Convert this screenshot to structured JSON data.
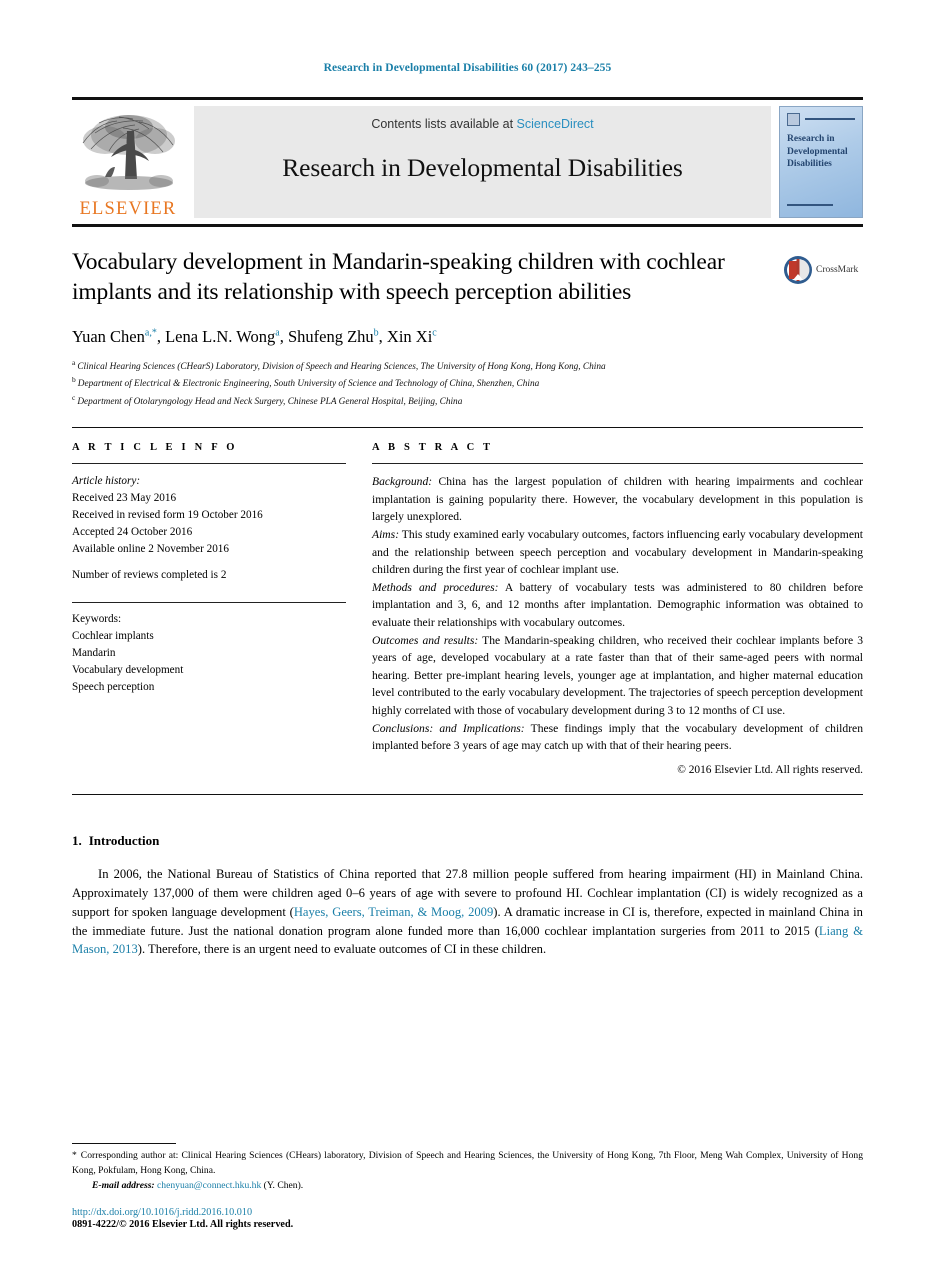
{
  "running_head": "Research in Developmental Disabilities 60 (2017) 243–255",
  "masthead": {
    "publisher_name": "ELSEVIER",
    "publisher_logo_icon": "elsevier-tree-icon",
    "contents_prefix": "Contents lists available at ",
    "contents_link": "ScienceDirect",
    "journal_name": "Research in Developmental Disabilities",
    "cover_title": "Research in Developmental Disabilities",
    "cover_icon": "journal-cover-mark-icon"
  },
  "article": {
    "title": "Vocabulary development in Mandarin-speaking children with cochlear implants and its relationship with speech perception abilities",
    "crossmark_label": "CrossMark",
    "crossmark_icon": "crossmark-logo-icon",
    "authors": [
      {
        "name": "Yuan Chen",
        "marks": "a,*"
      },
      {
        "name": "Lena L.N. Wong",
        "marks": "a"
      },
      {
        "name": "Shufeng Zhu",
        "marks": "b"
      },
      {
        "name": "Xin Xi",
        "marks": "c"
      }
    ],
    "affiliations": [
      {
        "mark": "a",
        "text": "Clinical Hearing Sciences (CHearS) Laboratory, Division of Speech and Hearing Sciences, The University of Hong Kong, Hong Kong, China"
      },
      {
        "mark": "b",
        "text": "Department of Electrical & Electronic Engineering, South University of Science and Technology of China, Shenzhen, China"
      },
      {
        "mark": "c",
        "text": "Department of Otolaryngology Head and Neck Surgery, Chinese PLA General Hospital, Beijing, China"
      }
    ]
  },
  "article_info": {
    "heading": "A R T I C L E   I N F O",
    "history_label": "Article history:",
    "history": [
      "Received 23 May 2016",
      "Received in revised form 19 October 2016",
      "Accepted 24 October 2016",
      "Available online 2 November 2016"
    ],
    "review_count_line": "Number of reviews completed is 2",
    "keywords_label": "Keywords:",
    "keywords": [
      "Cochlear implants",
      "Mandarin",
      "Vocabulary development",
      "Speech perception"
    ]
  },
  "abstract": {
    "heading": "A B S T R A C T",
    "sections": [
      {
        "label": "Background:",
        "text": " China has the largest population of children with hearing impairments and cochlear implantation is gaining popularity there. However, the vocabulary development in this population is largely unexplored."
      },
      {
        "label": "Aims:",
        "text": " This study examined early vocabulary outcomes, factors influencing early vocabulary development and the relationship between speech perception and vocabulary development in Mandarin-speaking children during the first year of cochlear implant use."
      },
      {
        "label": "Methods and procedures:",
        "text": " A battery of vocabulary tests was administered to 80 children before implantation and 3, 6, and 12 months after implantation. Demographic information was obtained to evaluate their relationships with vocabulary outcomes."
      },
      {
        "label": "Outcomes and results:",
        "text": " The Mandarin-speaking children, who received their cochlear implants before 3 years of age, developed vocabulary at a rate faster than that of their same-aged peers with normal hearing. Better pre-implant hearing levels, younger age at implantation, and higher maternal education level contributed to the early vocabulary development. The trajectories of speech perception development highly correlated with those of vocabulary development during 3 to 12 months of CI use."
      },
      {
        "label": "Conclusions: and Implications:",
        "text": " These findings imply that the vocabulary development of children implanted before 3 years of age may catch up with that of their hearing peers."
      }
    ],
    "copyright": "© 2016 Elsevier Ltd. All rights reserved."
  },
  "introduction": {
    "number": "1.",
    "title": "Introduction",
    "paragraph_part1": "In 2006, the National Bureau of Statistics of China reported that 27.8 million people suffered from hearing impairment (HI) in Mainland China. Approximately 137,000 of them were children aged 0–6 years of age with severe to profound HI. Cochlear implantation (CI) is widely recognized as a support for spoken language development (",
    "citation1": "Hayes, Geers, Treiman, & Moog, 2009",
    "paragraph_part2": "). A dramatic increase in CI is, therefore, expected in mainland China in the immediate future. Just the national donation program alone funded more than 16,000 cochlear implantation surgeries from 2011 to 2015 (",
    "citation2": "Liang & Mason, 2013",
    "paragraph_part3": "). Therefore, there is an urgent need to evaluate outcomes of CI in these children."
  },
  "footnotes": {
    "star": "*",
    "corresponding": "Corresponding author at: Clinical Hearing Sciences (CHears) laboratory, Division of Speech and Hearing Sciences, the University of Hong Kong, 7th Floor, Meng Wah Complex, University of Hong Kong, Pokfulam, Hong Kong, China.",
    "email_label": "E-mail address:",
    "email": "chenyuan@connect.hku.hk",
    "email_suffix": " (Y. Chen).",
    "doi": "http://dx.doi.org/10.1016/j.ridd.2016.10.010",
    "issn": "0891-4222/© 2016 Elsevier Ltd. All rights reserved."
  },
  "colors": {
    "link": "#1a7fa8",
    "elsevier_orange": "#E87722",
    "cover_blue": "#24456f",
    "sciencedirect": "#2a8fc0"
  }
}
